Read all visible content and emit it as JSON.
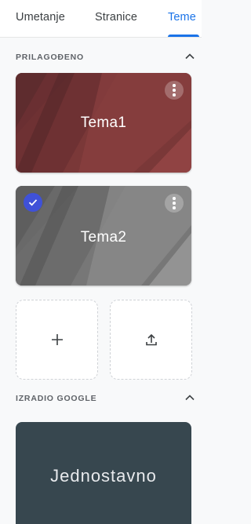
{
  "tabs": [
    {
      "label": "Umetanje"
    },
    {
      "label": "Stranice"
    },
    {
      "label": "Teme"
    }
  ],
  "colors": {
    "accent": "#1a73e8",
    "selected_badge": "#3f51d8"
  },
  "custom_section": {
    "header": "PRILAGOĐENO",
    "themes": [
      {
        "title": "Tema1",
        "selected": false,
        "base_color": "#7a3838"
      },
      {
        "title": "Tema2",
        "selected": true,
        "base_color": "#777777"
      }
    ],
    "add_button_icon": "plus-icon",
    "upload_button_icon": "upload-icon"
  },
  "google_section": {
    "header": "IZRADIO GOOGLE",
    "themes": [
      {
        "title": "Jednostavno",
        "base_color": "#37474f"
      }
    ]
  }
}
